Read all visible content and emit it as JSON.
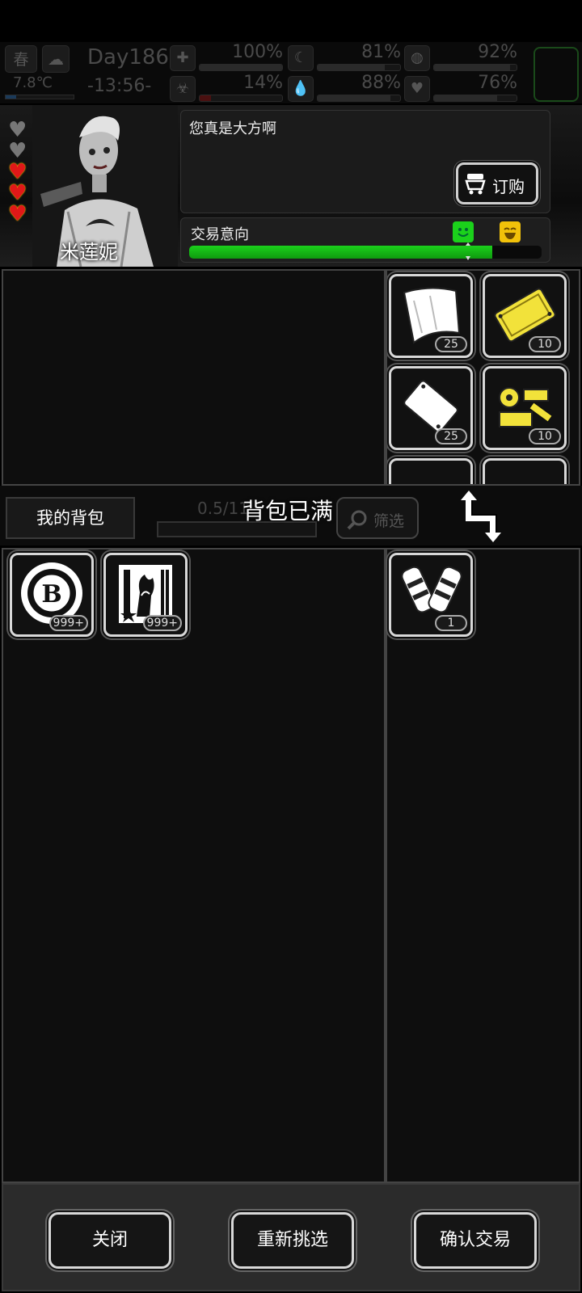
{
  "status": {
    "season": "春",
    "day": "Day186",
    "time": "-13:56-",
    "temperature": "7.8℃",
    "temp_level": 0.15,
    "stats": [
      {
        "icon": "health-icon",
        "value": "100%",
        "level": 1.0,
        "color": "#2a2a2a"
      },
      {
        "icon": "moon-icon",
        "value": "81%",
        "level": 0.81,
        "color": "#2a2a2a"
      },
      {
        "icon": "stomach-icon",
        "value": "92%",
        "level": 0.92,
        "color": "#2a2a2a"
      },
      {
        "icon": "infection-icon",
        "value": "14%",
        "level": 0.14,
        "color": "#4a1010"
      },
      {
        "icon": "water-drop-icon",
        "value": "88%",
        "level": 0.88,
        "color": "#2a2a2a"
      },
      {
        "icon": "heart-icon",
        "value": "76%",
        "level": 0.76,
        "color": "#2a2a2a"
      }
    ]
  },
  "npc": {
    "name": "米莲妮",
    "hearts": {
      "filled": 3,
      "total": 5
    },
    "dialog": "您真是大方啊",
    "order_label": "订购"
  },
  "trade": {
    "intent_label": "交易意向",
    "intent_level": 0.86,
    "accent_green": "#1bd11b",
    "accent_yellow": "#f2c20a"
  },
  "merchant_items": [
    {
      "name": "white-cloth-icon",
      "count": "25"
    },
    {
      "name": "gold-plate-icon",
      "count": "10"
    },
    {
      "name": "white-plate-icon",
      "count": "25"
    },
    {
      "name": "gold-parts-icon",
      "count": "10"
    }
  ],
  "midbar": {
    "my_bag": "我的背包",
    "weight": "0.5/11",
    "bag_full": "背包已满",
    "filter": "筛选"
  },
  "bag_items": [
    {
      "name": "bitcoin-coin-icon",
      "count": "999+"
    },
    {
      "name": "zombie-card-icon",
      "count": "999+"
    }
  ],
  "offer_items": [
    {
      "name": "leg-guards-icon",
      "count": "1"
    }
  ],
  "footer": {
    "close": "关闭",
    "reselect": "重新挑选",
    "confirm": "确认交易"
  }
}
